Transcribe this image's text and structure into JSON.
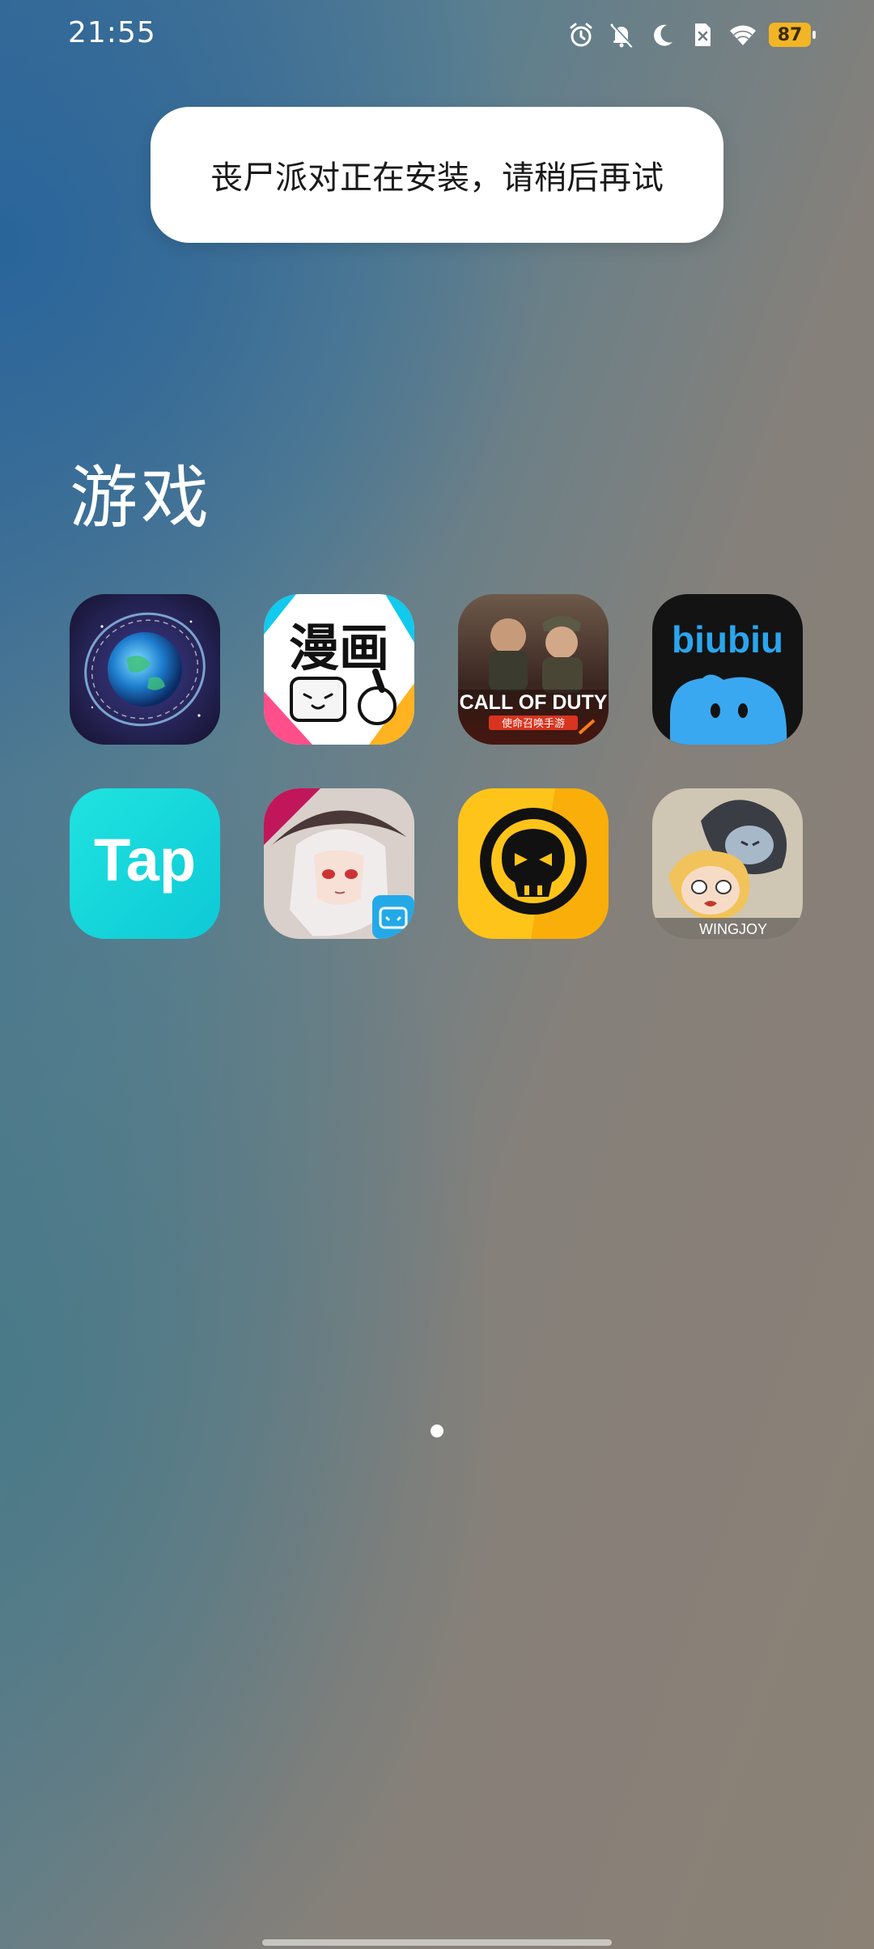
{
  "status_bar": {
    "time": "21:55",
    "battery_level": "87",
    "icons": [
      "alarm-icon",
      "mute-icon",
      "moon-icon",
      "sim-off-icon",
      "wifi-icon",
      "battery-icon"
    ]
  },
  "toast": {
    "message": "丧尸派对正在安装，请稍后再试"
  },
  "folder": {
    "title": "游戏",
    "apps": [
      {
        "icon": "cosmic-planet-game-icon"
      },
      {
        "icon": "bilibili-comics-icon",
        "label_art": "漫画"
      },
      {
        "icon": "call-of-duty-mobile-icon",
        "label_art": "CALL OF DUTY"
      },
      {
        "icon": "biubiu-icon",
        "label_art": "biubiu"
      },
      {
        "icon": "taptap-icon",
        "label_art": "Tap"
      },
      {
        "icon": "anime-girl-game-icon"
      },
      {
        "icon": "brawl-stars-icon"
      },
      {
        "icon": "wingjoy-chibi-game-icon",
        "label_art": "WINGJOY"
      }
    ]
  },
  "pager": {
    "current_page": 1,
    "total_pages": 1
  },
  "colors": {
    "battery": "#f2b526",
    "tap_cyan": "#12d6d9",
    "biubiu_blue": "#3aa8f0",
    "brawl_yellow": "#ffc41a"
  }
}
